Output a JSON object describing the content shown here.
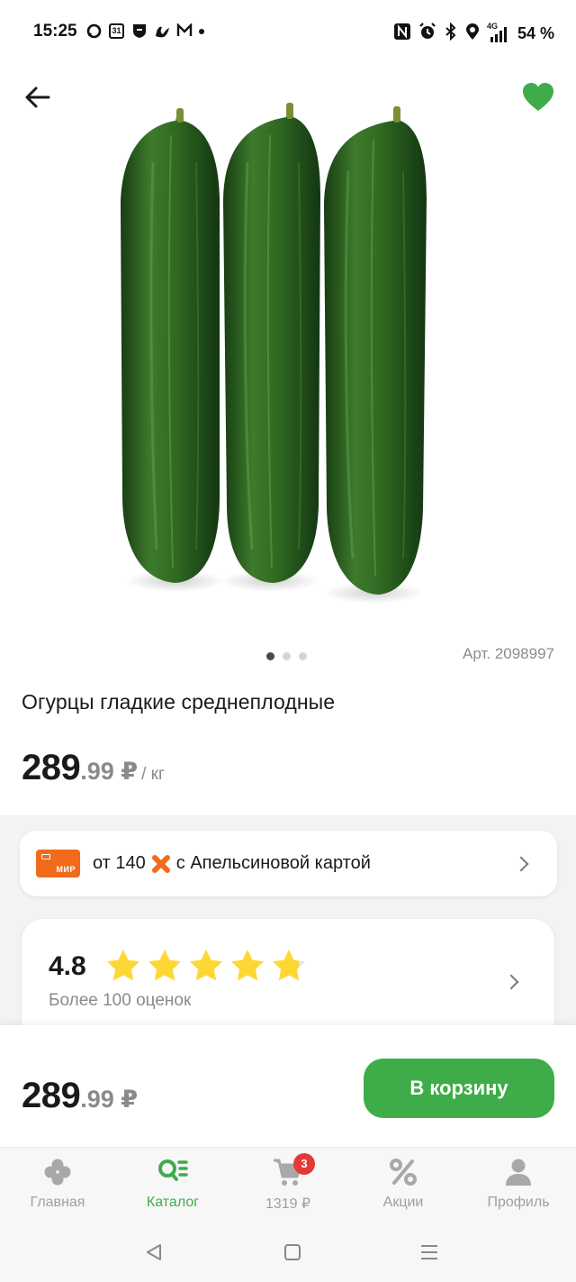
{
  "status_bar": {
    "time": "15:25",
    "left_icons": [
      "chat-icon",
      "calendar-icon",
      "shield-icon",
      "app-icon",
      "mail-icon",
      "dot-icon"
    ],
    "calendar_day": "31",
    "right_icons": [
      "nfc-icon",
      "alarm-icon",
      "bluetooth-icon",
      "location-icon",
      "signal-icon"
    ],
    "network": "4G",
    "battery": "54 %"
  },
  "header": {
    "back_icon": "arrow-left-icon",
    "favorite_icon": "heart-icon",
    "favorite_color": "#3fac4a"
  },
  "product": {
    "image_icon": "cucumbers-image",
    "carousel": {
      "count": 3,
      "active": 0
    },
    "article": "Арт. 2098997",
    "title": "Огурцы гладкие среднеплодные",
    "price_int": "289",
    "price_frac": ".99 ₽",
    "price_unit": "/ кг"
  },
  "offer": {
    "card_label": "МИР",
    "text_before": "от 140",
    "text_after": "с Апельсиновой картой",
    "accent_color": "#f26b1d"
  },
  "rating": {
    "value": "4.8",
    "stars": 4.8,
    "count_text": "Более 100 оценок",
    "star_color": "#fdd835"
  },
  "buy_bar": {
    "price_int": "289",
    "price_frac": ".99 ₽",
    "button_label": "В корзину",
    "button_color": "#3fac4a"
  },
  "tabs": [
    {
      "icon": "clover-icon",
      "label": "Главная",
      "active": false
    },
    {
      "icon": "catalog-search-icon",
      "label": "Каталог",
      "active": true
    },
    {
      "icon": "cart-icon",
      "label": "1319 ₽",
      "active": false,
      "badge": "3"
    },
    {
      "icon": "percent-icon",
      "label": "Акции",
      "active": false
    },
    {
      "icon": "profile-icon",
      "label": "Профиль",
      "active": false
    }
  ],
  "system_nav": [
    "back-triangle-icon",
    "home-square-icon",
    "menu-lines-icon"
  ]
}
